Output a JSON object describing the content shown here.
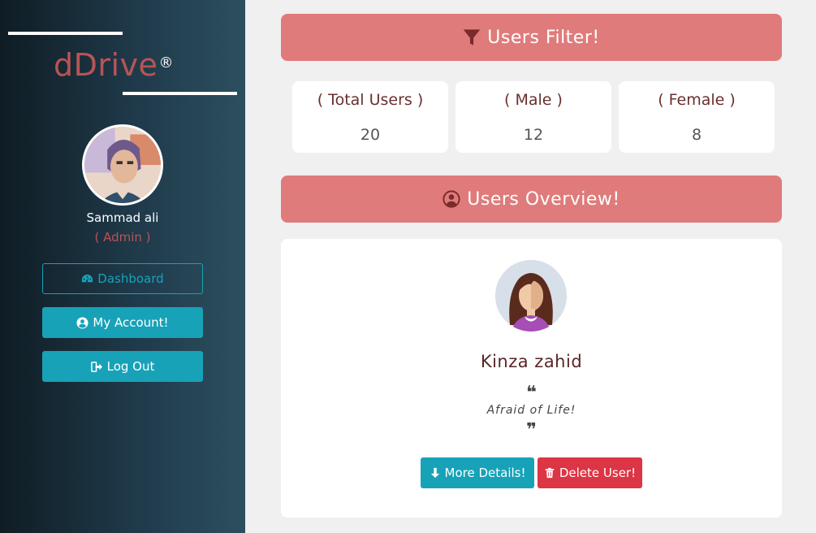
{
  "brand": {
    "name": "dDrive",
    "mark": "®"
  },
  "profile": {
    "name": "Sammad ali",
    "role": "( Admin )"
  },
  "nav": {
    "dashboard": {
      "label": "Dashboard",
      "icon": "dashboard-icon"
    },
    "account": {
      "label": "My Account!",
      "icon": "user-circle-icon"
    },
    "logout": {
      "label": "Log Out",
      "icon": "sign-out-icon"
    }
  },
  "filter_header": {
    "title": "Users Filter!",
    "icon": "filter-icon"
  },
  "stats": [
    {
      "label": "( Total Users )",
      "value": "20"
    },
    {
      "label": "( Male )",
      "value": "12"
    },
    {
      "label": "( Female )",
      "value": "8"
    }
  ],
  "overview_header": {
    "title": "Users Overview!",
    "icon": "user-circle-icon"
  },
  "user_card": {
    "name": "Kinza zahid",
    "bio": "Afraid of Life!",
    "more_label": "More Details!",
    "delete_label": "Delete User!"
  },
  "colors": {
    "accent": "#e07b7b",
    "info": "#17a2b8",
    "danger": "#dc3545",
    "brand": "#b85456"
  }
}
